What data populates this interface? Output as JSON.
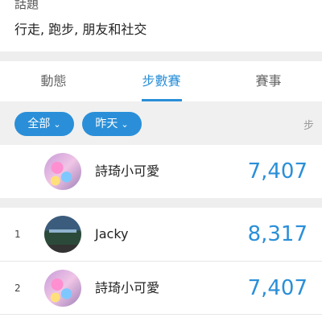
{
  "topic": {
    "title": "話題",
    "tags": "行走, 跑步, 朋友和社交"
  },
  "tabs": [
    {
      "label": "動態",
      "active": false
    },
    {
      "label": "步數賽",
      "active": true
    },
    {
      "label": "賽事",
      "active": false
    }
  ],
  "filters": {
    "scope": "全部",
    "date": "昨天",
    "unit": "步"
  },
  "my_entry": {
    "name": "詩琦小可愛",
    "steps": "7,407"
  },
  "leaderboard": [
    {
      "rank": "1",
      "name": "Jacky",
      "steps": "8,317"
    },
    {
      "rank": "2",
      "name": "詩琦小可愛",
      "steps": "7,407"
    }
  ],
  "colors": {
    "accent": "#2a8fd8",
    "background_gap": "#eeeeee"
  }
}
